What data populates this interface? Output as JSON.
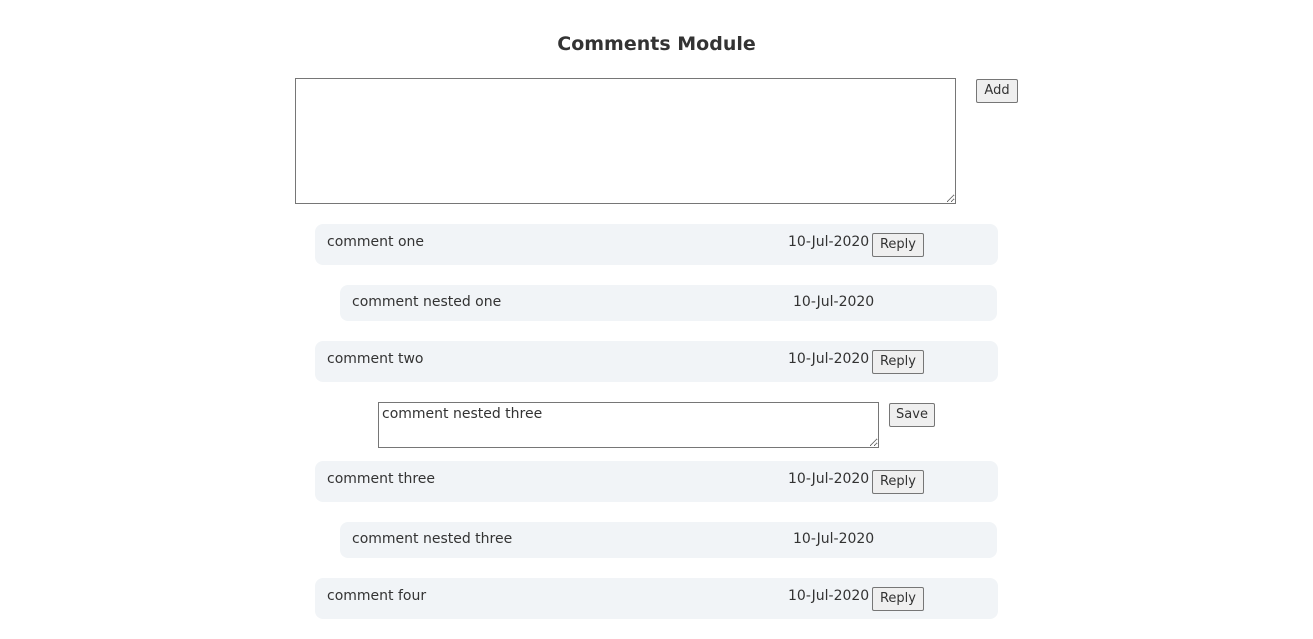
{
  "header": {
    "title": "Comments Module"
  },
  "composer": {
    "value": "",
    "add_label": "Add"
  },
  "comments": [
    {
      "text": "comment one",
      "date": "10-Jul-2020",
      "reply_label": "Reply"
    },
    {
      "text": "comment nested one",
      "date": "10-Jul-2020"
    },
    {
      "text": "comment two",
      "date": "10-Jul-2020",
      "reply_label": "Reply"
    },
    {
      "text": "comment three",
      "date": "10-Jul-2020",
      "reply_label": "Reply"
    },
    {
      "text": "comment nested three",
      "date": "10-Jul-2020"
    },
    {
      "text": "comment four",
      "date": "10-Jul-2020",
      "reply_label": "Reply"
    }
  ],
  "reply_editor": {
    "value": "comment nested three",
    "save_label": "Save"
  },
  "colors": {
    "comment_background": "#f1f4f7",
    "text": "#333333",
    "button_background": "#efefef",
    "border": "#767676"
  }
}
